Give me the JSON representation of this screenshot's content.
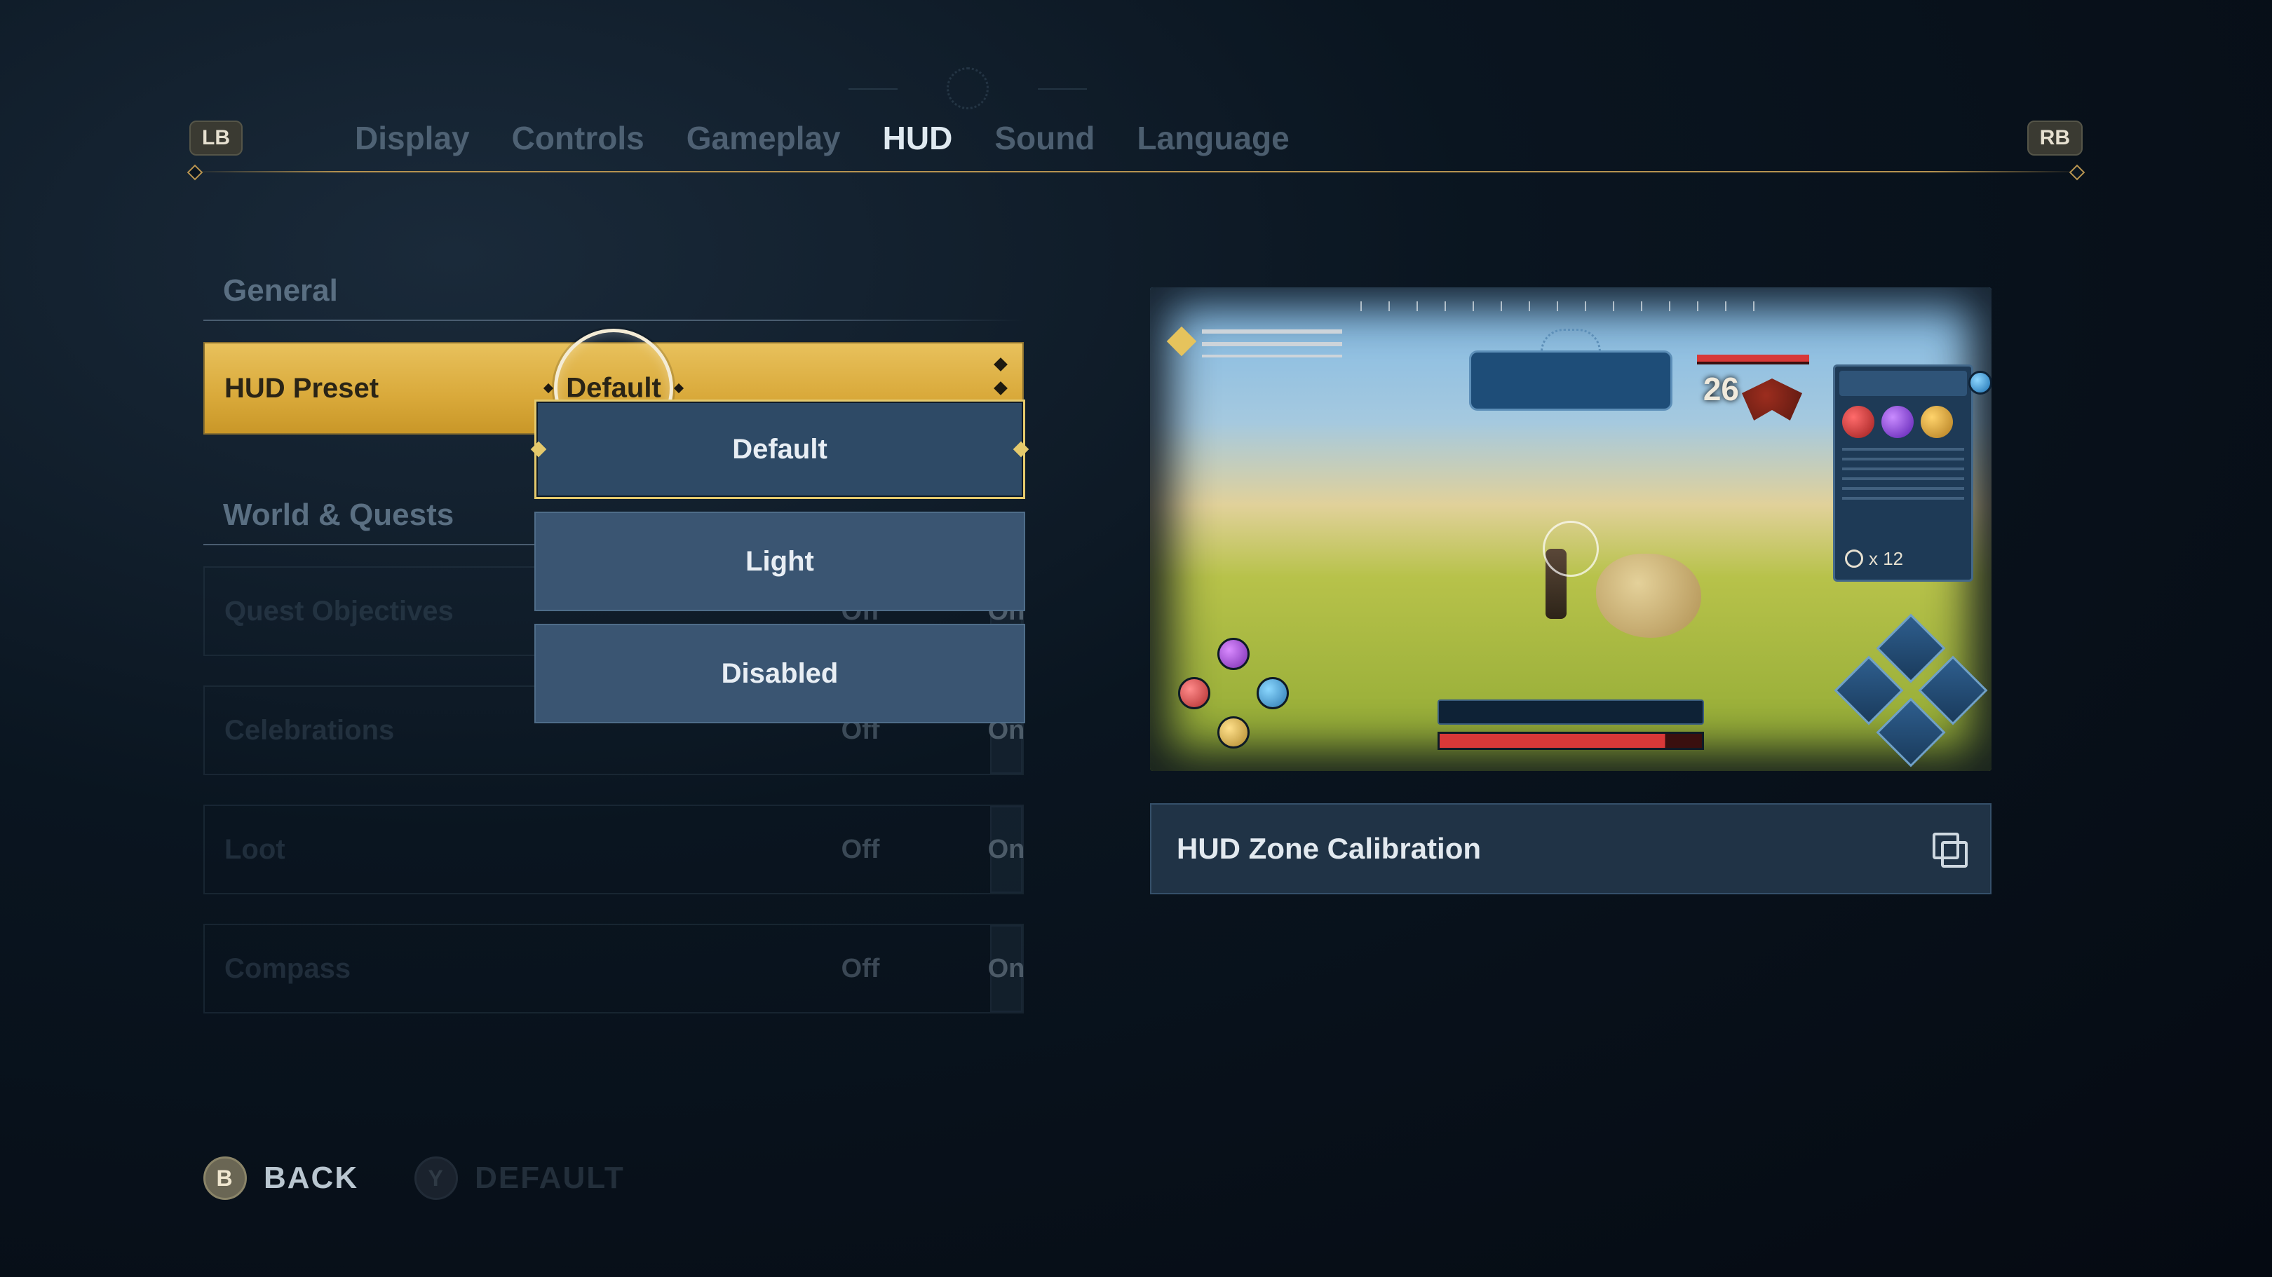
{
  "tabs": {
    "lb": "LB",
    "rb": "RB",
    "items": [
      "Display",
      "Controls",
      "Gameplay",
      "HUD",
      "Sound",
      "Language"
    ],
    "active": "HUD"
  },
  "sections": {
    "general": "General",
    "world": "World & Quests"
  },
  "hud_preset": {
    "label": "HUD Preset",
    "value": "Default",
    "options": [
      "Default",
      "Light",
      "Disabled"
    ],
    "selected": "Default"
  },
  "toggles": {
    "off": "Off",
    "on": "On",
    "quest_objectives": "Quest Objectives",
    "celebrations": "Celebrations",
    "loot": "Loot",
    "compass": "Compass"
  },
  "right": {
    "damage_number": "26",
    "loot_count": "x 12",
    "hud_zone": "HUD Zone Calibration"
  },
  "footer": {
    "b_glyph": "B",
    "back": "BACK",
    "y_glyph": "Y",
    "default": "DEFAULT"
  }
}
